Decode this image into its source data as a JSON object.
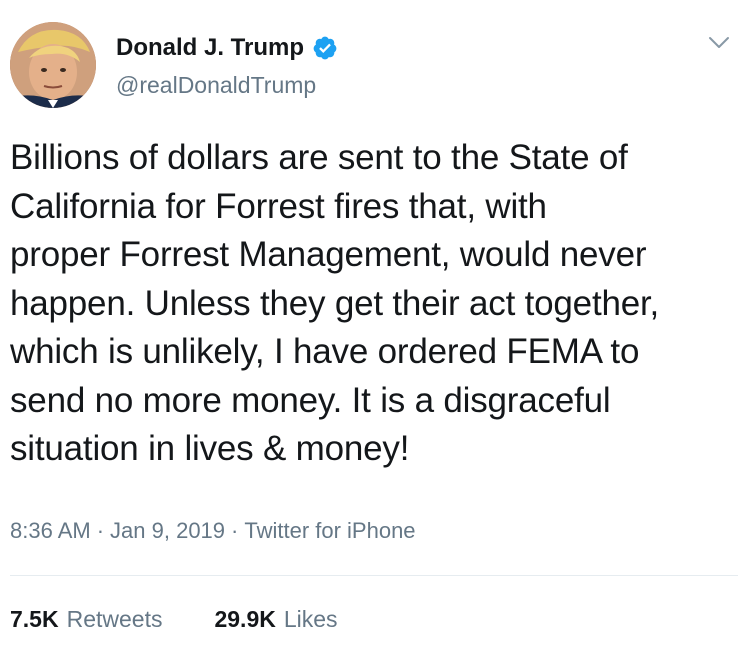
{
  "author": {
    "display_name": "Donald J. Trump",
    "handle": "@realDonaldTrump",
    "verified": true
  },
  "tweet": {
    "text": "Billions of dollars are sent to the State of\nCalifornia for Forrest fires that, with\nproper Forrest Management, would never\nhappen. Unless they get their act together,\nwhich is unlikely, I have ordered FEMA to\nsend no more money. It is a disgraceful\nsituation in lives & money!"
  },
  "meta": {
    "time": "8:36 AM",
    "separator1": "·",
    "date": "Jan 9, 2019",
    "separator2": "·",
    "source": "Twitter for iPhone"
  },
  "stats": {
    "retweets": {
      "count": "7.5K",
      "label": "Retweets"
    },
    "likes": {
      "count": "29.9K",
      "label": "Likes"
    }
  },
  "icons": {
    "verified": "verified-badge-icon",
    "menu": "chevron-down-icon"
  },
  "colors": {
    "verified": "#1da1f2",
    "secondary_text": "#657786",
    "primary_text": "#14171a",
    "divider": "#e6ecf0"
  }
}
